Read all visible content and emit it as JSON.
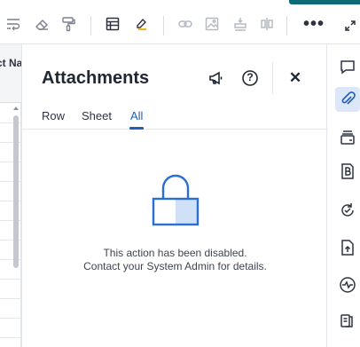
{
  "toolbar": {
    "icons": [
      "text-wrap-icon",
      "eraser-icon",
      "format-painter-icon",
      "grid-table-icon",
      "highlighter-icon",
      "link-icon",
      "image-icon",
      "row-height-icon",
      "column-gap-icon",
      "more-icon",
      "expand-icon"
    ],
    "more_label": "•••"
  },
  "grid": {
    "header_partial": "ct Na"
  },
  "panel": {
    "title": "Attachments",
    "tabs": [
      {
        "label": "Row",
        "active": false
      },
      {
        "label": "Sheet",
        "active": false
      },
      {
        "label": "All",
        "active": true
      }
    ],
    "message_line1": "This action has been disabled.",
    "message_line2": "Contact your System Admin for details.",
    "close_label": "✕",
    "help_label": "?"
  },
  "rail": {
    "icons": [
      "comment-icon",
      "attachment-icon",
      "card-stack-icon",
      "publish-icon",
      "refresh-icon",
      "upload-icon",
      "activity-icon",
      "summary-icon"
    ],
    "active": "attachment-icon"
  },
  "colors": {
    "accent": "#1f5fbf",
    "teal": "#0f6b73",
    "lock_blue": "#2a6fd4",
    "lock_fill": "#cfe0f7"
  }
}
